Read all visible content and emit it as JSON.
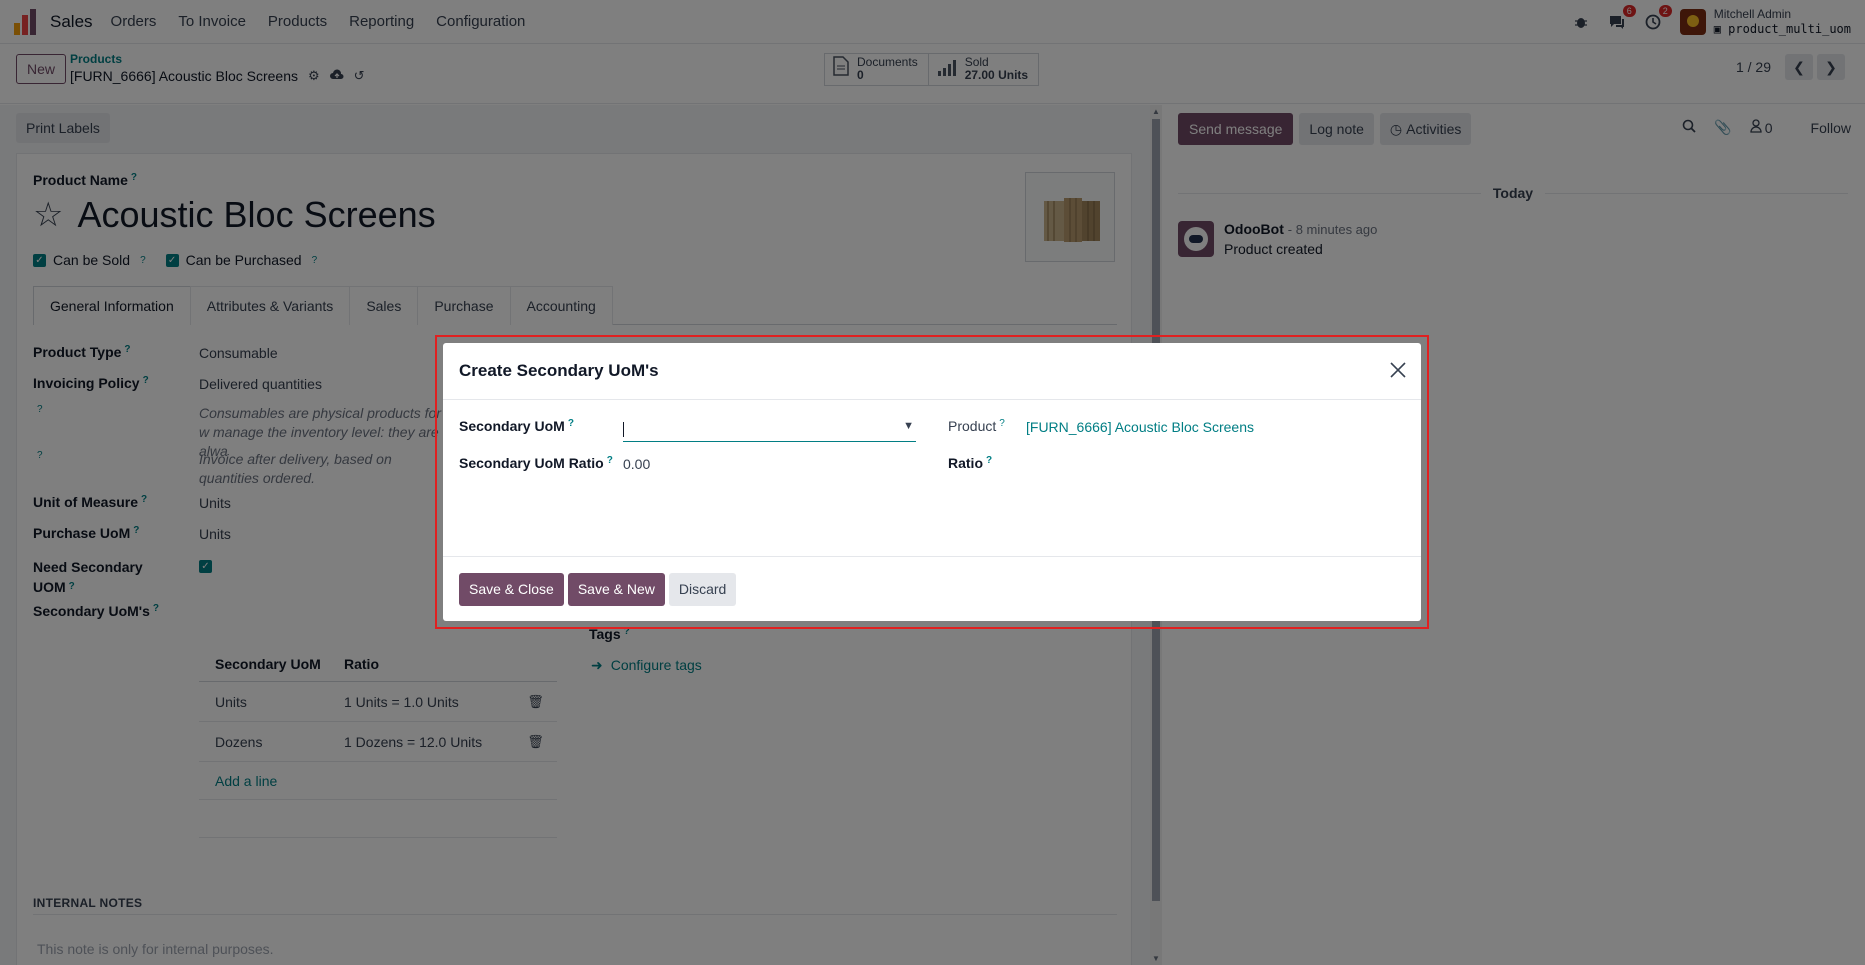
{
  "navbar": {
    "app_name": "Sales",
    "menu": [
      "Orders",
      "To Invoice",
      "Products",
      "Reporting",
      "Configuration"
    ],
    "chat_badge": "6",
    "activity_badge": "2",
    "user_name": "Mitchell Admin",
    "database": "product_multi_uom"
  },
  "control": {
    "new_label": "New",
    "breadcrumb_parent": "Products",
    "breadcrumb_current": "[FURN_6666] Acoustic Bloc Screens",
    "documents_label": "Documents",
    "documents_value": "0",
    "sold_label": "Sold",
    "sold_value": "27.00 Units",
    "pager": "1 / 29"
  },
  "form": {
    "print_labels": "Print Labels",
    "product_name_label": "Product Name",
    "product_name": "Acoustic Bloc Screens",
    "can_be_sold": "Can be Sold",
    "can_be_purchased": "Can be Purchased",
    "tabs": [
      "General Information",
      "Attributes & Variants",
      "Sales",
      "Purchase",
      "Accounting"
    ],
    "product_type_label": "Product Type",
    "product_type": "Consumable",
    "invoicing_policy_label": "Invoicing Policy",
    "invoicing_policy": "Delivered quantities",
    "help_consumable": "Consumables are physical products for w manage the inventory level: they are alwa",
    "help_invoice": "Invoice after delivery, based on quantities ordered.",
    "uom_label": "Unit of Measure",
    "uom": "Units",
    "purchase_uom_label": "Purchase UoM",
    "purchase_uom": "Units",
    "need_secondary_label": "Need Secondary UOM",
    "secondary_uoms_label": "Secondary UoM's",
    "secondary_table": {
      "headers": [
        "Secondary UoM",
        "Ratio"
      ],
      "rows": [
        {
          "uom": "Units",
          "ratio": "1 Units = 1.0 Units"
        },
        {
          "uom": "Dozens",
          "ratio": "1 Dozens = 12.0 Units"
        }
      ],
      "add_line": "Add a line"
    },
    "tags_label": "Tags",
    "configure_tags": "Configure tags",
    "internal_notes_title": "INTERNAL NOTES",
    "internal_notes_placeholder": "This note is only for internal purposes."
  },
  "chatter": {
    "send_message": "Send message",
    "log_note": "Log note",
    "activities": "Activities",
    "followers_count": "0",
    "follow": "Follow",
    "today": "Today",
    "message": {
      "author": "OdooBot",
      "time": "- 8 minutes ago",
      "body": "Product created"
    }
  },
  "modal": {
    "title": "Create Secondary UoM's",
    "secondary_uom_label": "Secondary UoM",
    "secondary_uom_value": "",
    "ratio_label": "Secondary UoM Ratio",
    "ratio_value": "0.00",
    "product_label": "Product",
    "product_value": "[FURN_6666] Acoustic Bloc Screens",
    "ratio2_label": "Ratio",
    "save_close": "Save & Close",
    "save_new": "Save & New",
    "discard": "Discard"
  },
  "colors": {
    "brand": "#714b67",
    "link": "#017e84",
    "highlight": "#e02020"
  },
  "icons": [
    "app-logo",
    "bug-icon",
    "chat-icon",
    "clock-icon",
    "gear-icon",
    "cloud-upload-icon",
    "undo-icon",
    "document-icon",
    "bar-chart-icon",
    "chevron-left-icon",
    "chevron-right-icon",
    "star-icon",
    "trash-icon",
    "arrow-right-icon",
    "search-icon",
    "paperclip-icon",
    "user-icon",
    "close-icon",
    "caret-down-icon"
  ]
}
